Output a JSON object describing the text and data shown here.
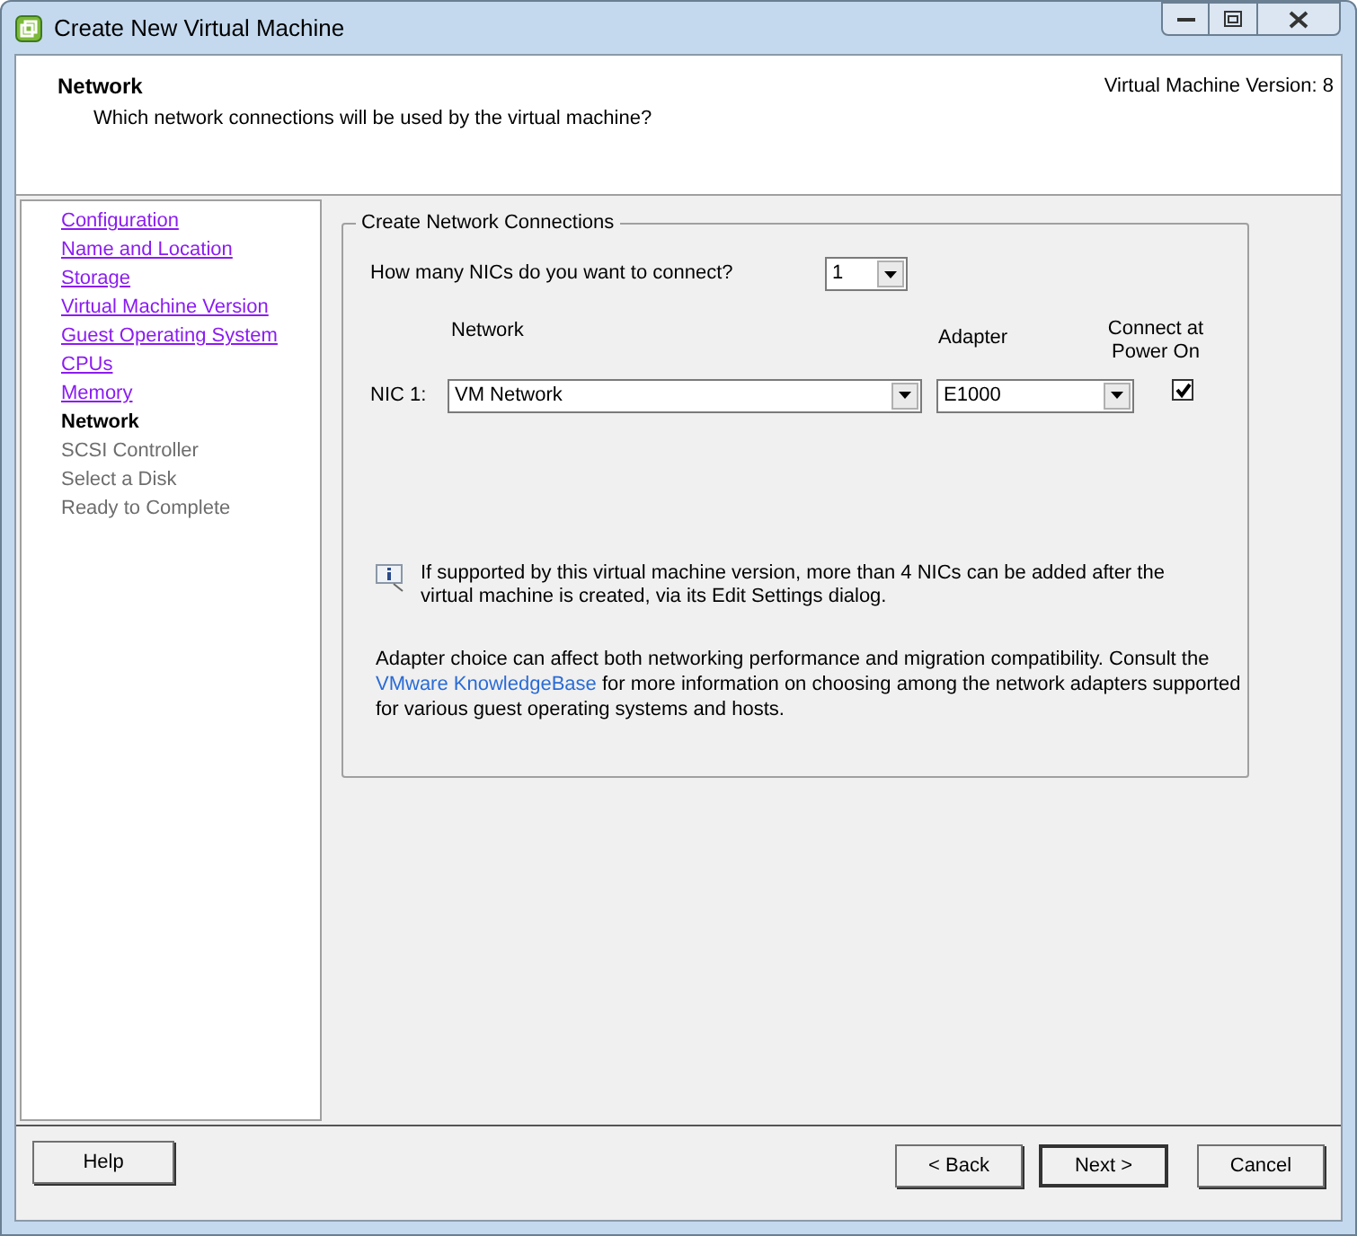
{
  "window": {
    "title": "Create New Virtual Machine"
  },
  "header": {
    "title": "Network",
    "subtitle": "Which network connections will be used by the virtual machine?",
    "version": "Virtual Machine Version: 8"
  },
  "steps": [
    {
      "label": "Configuration",
      "kind": "done"
    },
    {
      "label": "Name and Location",
      "kind": "done"
    },
    {
      "label": "Storage",
      "kind": "done"
    },
    {
      "label": "Virtual Machine Version",
      "kind": "done"
    },
    {
      "label": "Guest Operating System",
      "kind": "done"
    },
    {
      "label": "CPUs",
      "kind": "done"
    },
    {
      "label": "Memory",
      "kind": "done"
    },
    {
      "label": "Network",
      "kind": "current"
    },
    {
      "label": "SCSI Controller",
      "kind": "pending"
    },
    {
      "label": "Select a Disk",
      "kind": "pending"
    },
    {
      "label": "Ready to Complete",
      "kind": "pending"
    }
  ],
  "group": {
    "title": "Create Network Connections",
    "nic_question": "How many NICs do you want to connect?",
    "nic_count": "1",
    "columns": {
      "network": "Network",
      "adapter": "Adapter",
      "connect": "Connect at Power On"
    },
    "nics": [
      {
        "label": "NIC 1:",
        "network": "VM Network",
        "adapter": "E1000",
        "connect_at_power_on": true
      }
    ],
    "info": "If supported by this virtual machine version, more than 4 NICs can be added after the virtual machine is created, via its Edit Settings dialog.",
    "note": {
      "before": "Adapter choice can affect both networking performance and migration compatibility. Consult the ",
      "link": "VMware KnowledgeBase",
      "after": " for more information on choosing among the network adapters supported for various guest operating systems and hosts."
    }
  },
  "buttons": {
    "help": "Help",
    "back": "< Back",
    "next": "Next >",
    "cancel": "Cancel"
  }
}
